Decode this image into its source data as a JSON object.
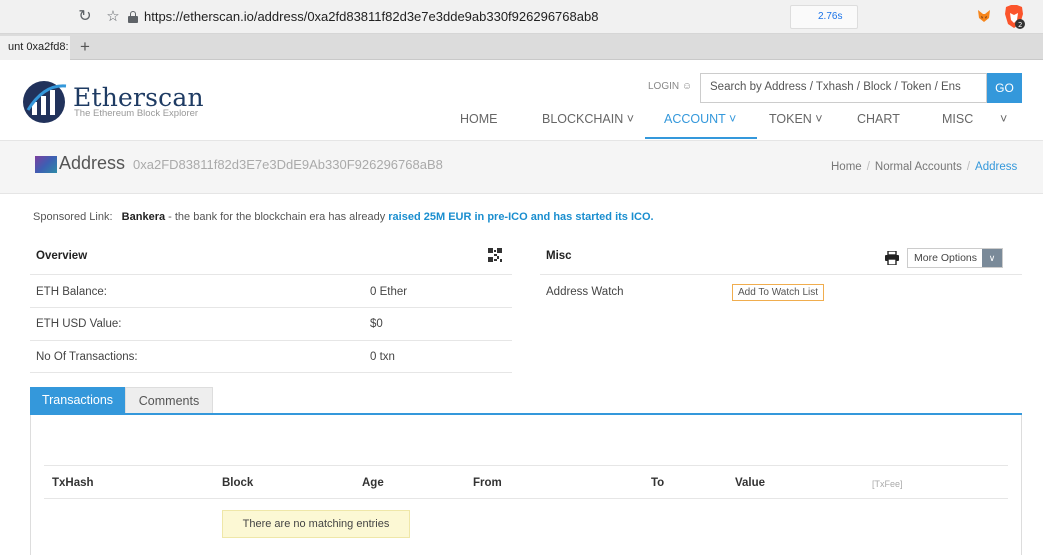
{
  "browser": {
    "url": "https://etherscan.io/address/0xa2fd83811f82d3e7e3dde9ab330f926296768ab8",
    "timing": "2.76s",
    "tab_title": "unt 0xa2fd8:",
    "new_tab_label": "+",
    "reload_icon": "reload-icon",
    "bookmark_icon": "star-icon"
  },
  "site": {
    "name": "Etherscan",
    "tagline": "The Ethereum Block Explorer",
    "login_label": "LOGIN",
    "search_placeholder": "Search by Address / Txhash / Block / Token / Ens",
    "search_button": "GO",
    "accent_color": "#3498db"
  },
  "nav": {
    "items": [
      {
        "label": "HOME"
      },
      {
        "label": "BLOCKCHAIN ˅"
      },
      {
        "label": "ACCOUNT ˅"
      },
      {
        "label": "TOKEN ˅"
      },
      {
        "label": "CHART"
      },
      {
        "label": "MISC"
      },
      {
        "label": "˅"
      }
    ],
    "active": "ACCOUNT"
  },
  "page": {
    "title": "Address",
    "address": "0xa2FD83811f82d3E7e3DdE9Ab330F926296768aB8",
    "breadcrumb": [
      "Home",
      "Normal Accounts",
      "Address"
    ]
  },
  "sponsored": {
    "prefix": "Sponsored Link:",
    "brand": "Bankera",
    "text": " - the bank for the blockchain era has already ",
    "link": "raised 25M EUR in pre-ICO and has started its ICO."
  },
  "overview": {
    "heading": "Overview",
    "rows": [
      {
        "label": "ETH Balance:",
        "value": "0 Ether"
      },
      {
        "label": "ETH USD Value:",
        "value": "$0"
      },
      {
        "label": "No Of Transactions:",
        "value": "0 txn"
      }
    ]
  },
  "misc": {
    "heading": "Misc",
    "address_watch_label": "Address Watch",
    "watch_button": "Add To Watch List",
    "more_options": "More Options"
  },
  "tabs": {
    "items": [
      {
        "label": "Transactions"
      },
      {
        "label": "Comments"
      }
    ],
    "active": "Transactions"
  },
  "table": {
    "columns": [
      "TxHash",
      "Block",
      "Age",
      "From",
      "To",
      "Value",
      "[TxFee]"
    ],
    "empty_message": "There are no matching entries"
  }
}
